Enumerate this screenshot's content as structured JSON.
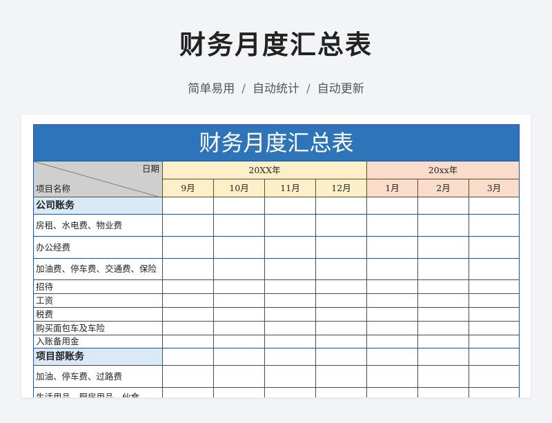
{
  "page": {
    "title": "财务月度汇总表",
    "tags": [
      "简单易用",
      "自动统计",
      "自动更新"
    ],
    "separator": "/"
  },
  "sheet": {
    "title": "财务月度汇总表",
    "date_header": "日期",
    "item_header": "项目名称",
    "year_a": "20XX年",
    "year_b": "20xx年",
    "months_a": [
      "9月",
      "10月",
      "11月",
      "12月"
    ],
    "months_b": [
      "1月",
      "2月",
      "3月"
    ],
    "sections": [
      {
        "name": "公司账务",
        "rows": [
          "房租、水电费、物业费",
          "办公经费",
          "加油费、停车费、交通费、保险",
          "招待",
          "工资",
          "税费",
          "购买面包车及车险",
          "入账备用金"
        ]
      },
      {
        "name": "项目部账务",
        "rows": [
          "加油、停车费、过路费",
          "生活用品、厨房用品、伙食"
        ]
      }
    ]
  }
}
